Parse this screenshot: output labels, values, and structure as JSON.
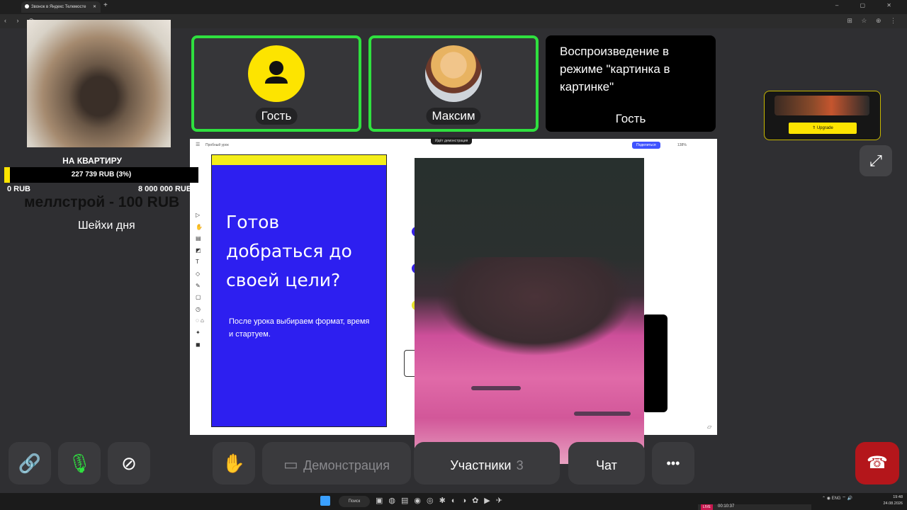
{
  "browser": {
    "tab_title": "Звонок в Яндекс Телемосте",
    "tab_close": "✕",
    "new_tab": "+",
    "window_controls": "–  ▢  ✕",
    "nav_buttons": "‹ › ⟳",
    "extension_icons": "⊞ ☆ ⊕ ⋮"
  },
  "participants": [
    {
      "name": "Гость",
      "icon": "user-icon",
      "active": true
    },
    {
      "name": "Максим",
      "icon": "photo-avatar",
      "active": true
    },
    {
      "name": "Гость",
      "pip_message": "Воспроизведение в режиме \"картинка в картинке\"",
      "active": false
    }
  ],
  "screen_share": {
    "indicator": "Идёт демонстрация",
    "doc_breadcrumb": "Пробный урок",
    "share_button": "Поделиться",
    "zoom": "138%",
    "slide": {
      "title": "Готов добраться до своей цели?",
      "subtitle": "После урока выбираем формат, время и стартуем.",
      "background": "#2d1ff0",
      "stripe": "#f4ee1a"
    },
    "tool_icons": "▷ ✋ ▤ ◩ T ◇ ✎ ▢ ◷ ◌ ⌂ ✦ ◼"
  },
  "donation_goal": {
    "title": "НА КВАРТИРУ",
    "collected": "227 739 RUB (3%)",
    "progress_percent": 3,
    "min": "0 RUB",
    "max": "8 000 000 RUB",
    "last_donation": "меллстрой - 100 RUB",
    "caption": "Шейхи дня"
  },
  "ad": {
    "button": "⇑ Upgrade"
  },
  "controls": {
    "link_icon": "🔗",
    "mic_icon": "🎙",
    "camera_off_icon": "⊘",
    "raise_hand_icon": "✋",
    "screen_icon": "▭",
    "demo_label": "Демонстрация",
    "participants_label": "Участники",
    "participants_count": "3",
    "chat_label": "Чат",
    "more_icon": "•••",
    "end_call_icon": "☎"
  },
  "taskbar": {
    "search_label": "Поиск",
    "tray": "⌃  ◉  ENG  ⌔  🔊",
    "time": "19:48",
    "date": "24.08.2026",
    "rec_live": "LIVE",
    "rec_time": "00:10:37"
  },
  "colors": {
    "active_border": "#2fe03f",
    "accent_yellow": "#fde400",
    "end_call_red": "#b4161b"
  }
}
